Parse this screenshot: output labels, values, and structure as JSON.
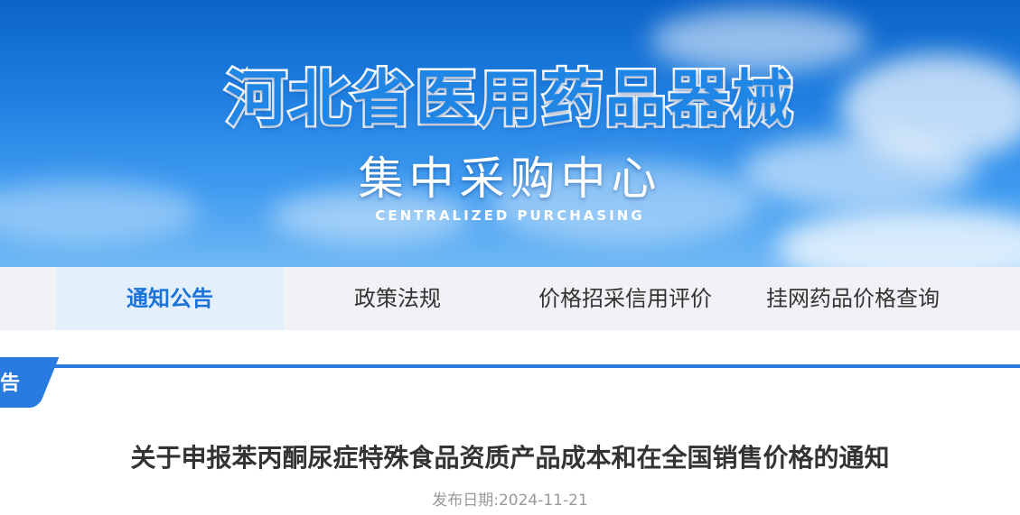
{
  "header": {
    "title_cn": "河北省医用药品器械",
    "subtitle_cn": "集中采购中心",
    "subtitle_en": "CENTRALIZED PURCHASING"
  },
  "nav": {
    "items": [
      {
        "label": "通知公告",
        "active": true
      },
      {
        "label": "政策法规",
        "active": false
      },
      {
        "label": "价格招采信用评价",
        "active": false
      },
      {
        "label": "挂网药品价格查询",
        "active": false
      }
    ]
  },
  "section": {
    "label": "告"
  },
  "article": {
    "title": "关于申报苯丙酮尿症特殊食品资质产品成本和在全国销售价格的通知",
    "publish_date": "发布日期:2024-11-21"
  },
  "colors": {
    "accent": "#2a7be0",
    "nav_active_text": "#1a73d9",
    "nav_active_bg": "#e3effb"
  }
}
